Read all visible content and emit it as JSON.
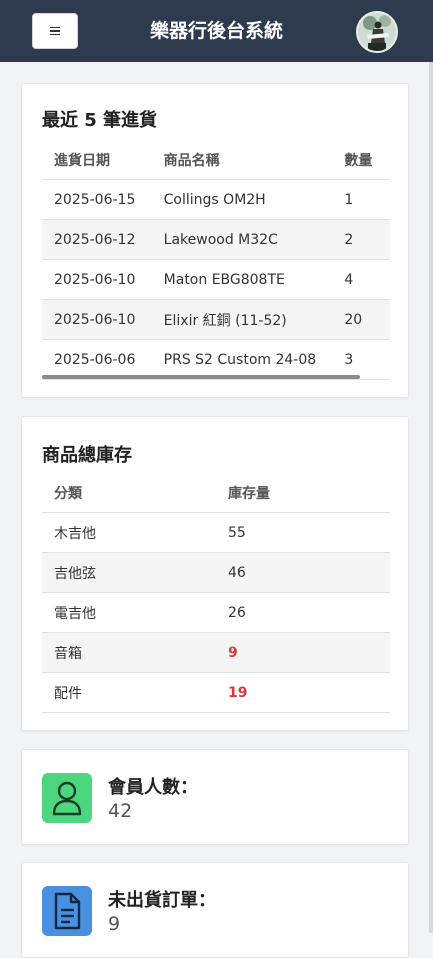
{
  "header": {
    "menu_icon": "hamburger-icon",
    "title": "樂器行後台系統",
    "avatar_icon": "user-avatar"
  },
  "recent_purchases": {
    "title": "最近 5 筆進貨",
    "columns": [
      "進貨日期",
      "商品名稱",
      "數量"
    ],
    "rows": [
      {
        "date": "2025-06-15",
        "product": "Collings OM2H",
        "qty": "1"
      },
      {
        "date": "2025-06-12",
        "product": "Lakewood M32C",
        "qty": "2"
      },
      {
        "date": "2025-06-10",
        "product": "Maton EBG808TE",
        "qty": "4"
      },
      {
        "date": "2025-06-10",
        "product": "Elixir 紅銅 (11-52)",
        "qty": "20"
      },
      {
        "date": "2025-06-06",
        "product": "PRS S2 Custom 24-08",
        "qty": "3"
      }
    ]
  },
  "inventory": {
    "title": "商品總庫存",
    "columns": [
      "分類",
      "庫存量"
    ],
    "rows": [
      {
        "category": "木吉他",
        "stock": "55",
        "low": false
      },
      {
        "category": "吉他弦",
        "stock": "46",
        "low": false
      },
      {
        "category": "電吉他",
        "stock": "26",
        "low": false
      },
      {
        "category": "音箱",
        "stock": "9",
        "low": true
      },
      {
        "category": "配件",
        "stock": "19",
        "low": true
      }
    ],
    "low_color": "#d9393b"
  },
  "stats": [
    {
      "label": "會員人數：",
      "value": "42",
      "icon": "member-icon",
      "color": "#4cd77f"
    },
    {
      "label": "未出貨訂單：",
      "value": "9",
      "icon": "document-icon",
      "color": "#4a90e2"
    }
  ]
}
